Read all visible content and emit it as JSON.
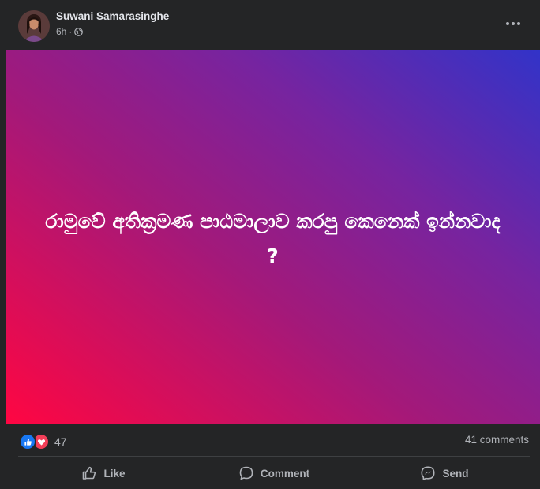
{
  "post": {
    "author": "Suwani Samarasinghe",
    "time": "6h",
    "separator": "·",
    "audience_icon": "globe-icon",
    "text": "රාමුවේ අතික්‍රමණ පාඨමාලාව කරපු කෙනෙක් ඉන්නවාද ?",
    "background_gradient": [
      "#ff0642",
      "#a3197a",
      "#7624a0",
      "#3233c8"
    ]
  },
  "stats": {
    "reactions_count": "47",
    "reaction_icons": [
      "like-icon",
      "love-icon"
    ],
    "comments": "41 comments"
  },
  "actions": {
    "like": "Like",
    "comment": "Comment",
    "send": "Send"
  },
  "colors": {
    "card_bg": "#242526",
    "text_primary": "#e4e6eb",
    "text_secondary": "#b0b3b8",
    "like_blue": "#1877f2",
    "love_red": "#f33e58"
  }
}
